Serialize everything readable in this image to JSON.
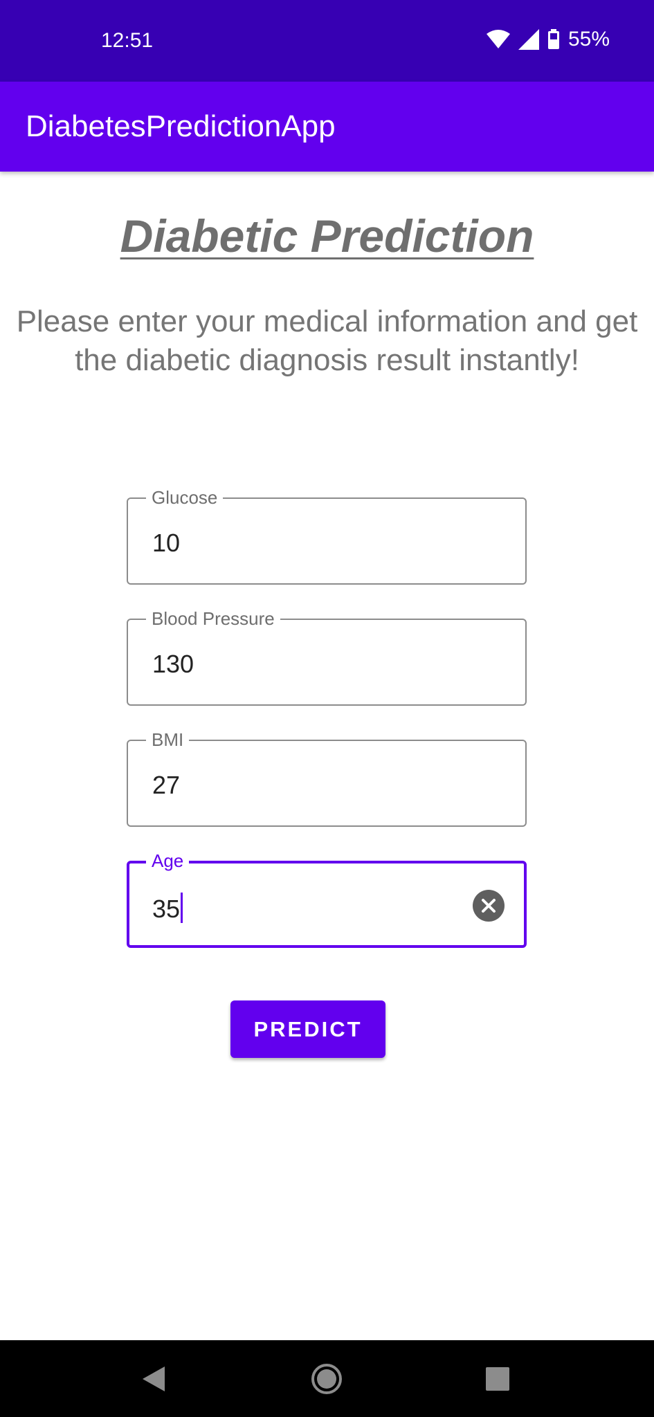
{
  "status_bar": {
    "time": "12:51",
    "battery": "55%",
    "icons": [
      "wifi-icon",
      "cellular-signal-icon",
      "battery-icon"
    ]
  },
  "app_bar": {
    "title": "DiabetesPredictionApp"
  },
  "main": {
    "heading": "Diabetic Prediction",
    "subtitle": "Please enter your medical information and get the diabetic diagnosis result instantly!",
    "fields": [
      {
        "label": "Glucose",
        "value": "10"
      },
      {
        "label": "Blood Pressure",
        "value": "130"
      },
      {
        "label": "BMI",
        "value": "27"
      },
      {
        "label": "Age",
        "value": "35",
        "focused": true
      }
    ],
    "predict_label": "PREDICT"
  },
  "nav_bar": {
    "icons": [
      "back-icon",
      "home-icon",
      "recents-icon"
    ]
  },
  "colors": {
    "status_bar": "#3700B3",
    "app_bar": "#6200EE",
    "accent": "#6200EE",
    "heading_text": "#6f6f6f",
    "subtitle_text": "#757575"
  }
}
